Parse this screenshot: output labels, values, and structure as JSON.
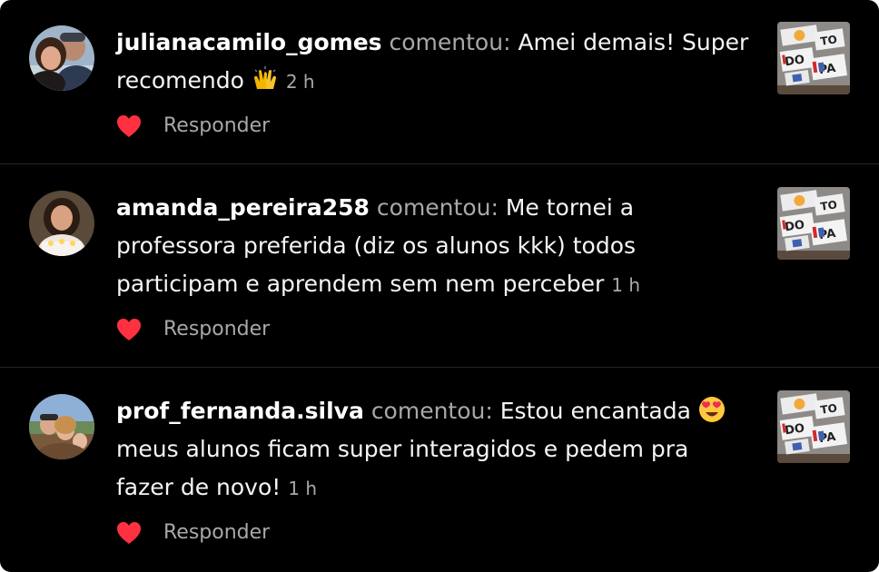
{
  "comments": [
    {
      "username": "julianacamilo_gomes",
      "verb": "comentou:",
      "text": "Amei demais! Super recomendo",
      "emoji": "raising-hands",
      "time": "2 h",
      "reply_label": "Responder",
      "liked": true
    },
    {
      "username": "amanda_pereira258",
      "verb": "comentou:",
      "text": "Me tornei a professora preferida (diz os alunos kkk) todos participam e aprendem sem nem perceber",
      "time": "1 h",
      "reply_label": "Responder",
      "liked": true
    },
    {
      "username": "prof_fernanda.silva",
      "verb": "comentou:",
      "text_part1": "Estou encantada",
      "emoji": "heart-eyes",
      "text_part2": "meus alunos ficam super interagidos e pedem pra fazer de novo!",
      "time": "1 h",
      "reply_label": "Responder",
      "liked": true
    }
  ],
  "thumbnail": {
    "labels": [
      "DO",
      "TO",
      "PA"
    ]
  },
  "colors": {
    "background": "#000000",
    "heart": "#ff3040",
    "muted_text": "#a8a8a8",
    "divider": "#262626"
  }
}
